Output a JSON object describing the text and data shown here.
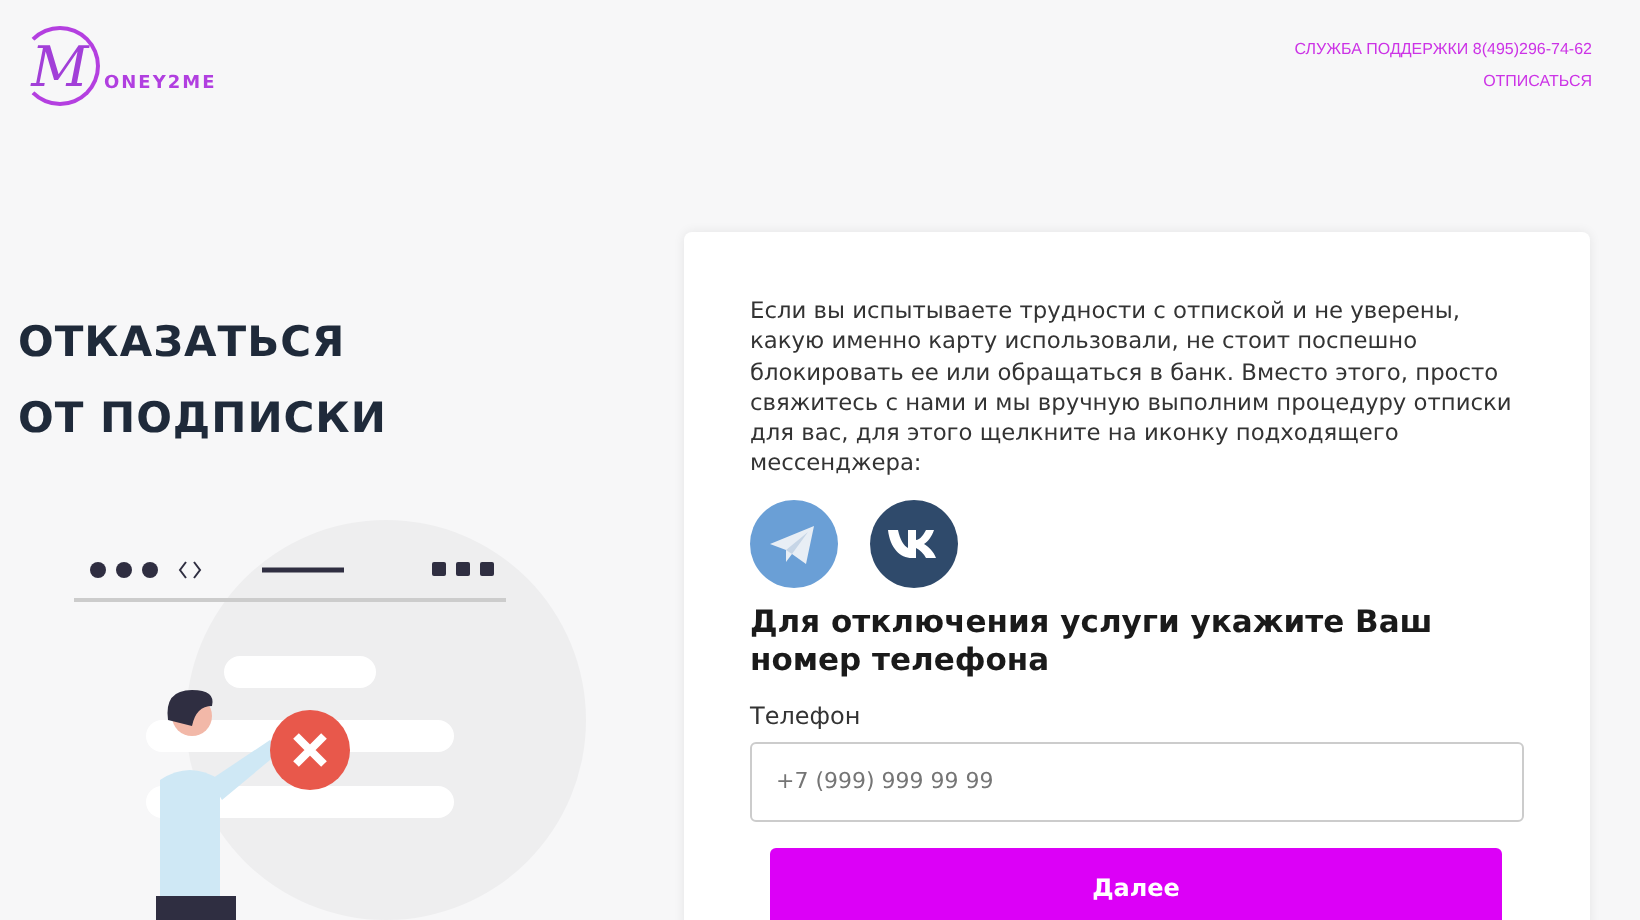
{
  "logo": {
    "initial": "M",
    "rest": "ONEY2ME"
  },
  "header": {
    "support": "СЛУЖБА ПОДДЕРЖКИ 8(495)296-74-62",
    "unsubscribe": "ОТПИСАТЬСЯ"
  },
  "hero": {
    "title": "ОТКАЗАТЬСЯ ОТ ПОДПИСКИ"
  },
  "card": {
    "intro": "Если вы испытываете трудности с отпиской и не уверены, какую именно карту использовали, не стоит поспешно блокировать ее или обращаться в банк. Вместо этого, просто свяжитесь с нами и мы вручную выполним процедуру отписки для вас, для этого щелкните на иконку подходящего мессенджера:",
    "messengers": [
      {
        "kind": "plane"
      },
      {
        "kind": "vk"
      }
    ],
    "heading": "Для отключения услуги укажите Ваш номер телефона",
    "phone_label": "Телефон",
    "phone_placeholder": "+7 (999) 999 99 99",
    "submit": "Далее"
  }
}
